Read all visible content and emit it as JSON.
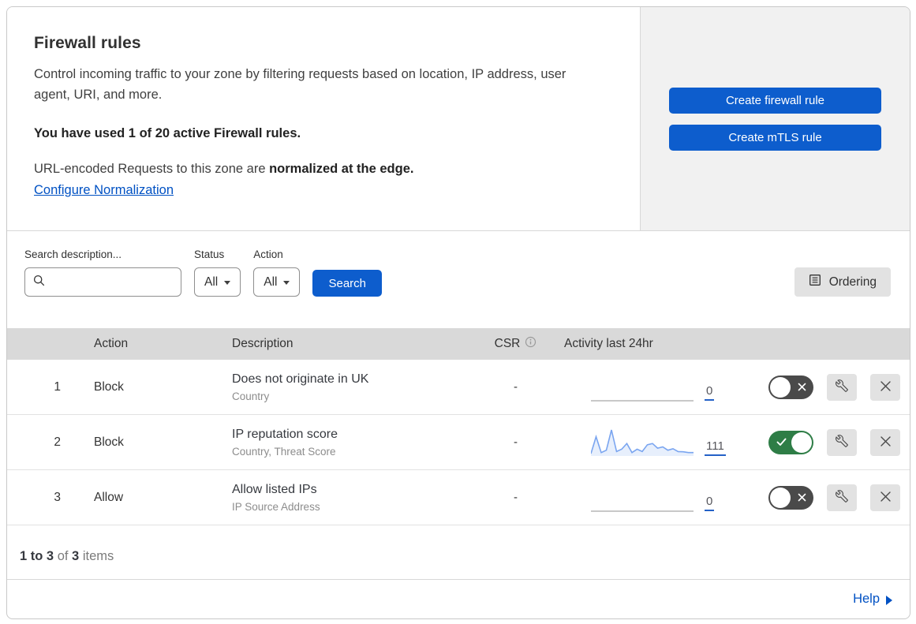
{
  "header": {
    "title": "Firewall rules",
    "description": "Control incoming traffic to your zone by filtering requests based on location, IP address, user agent, URI, and more.",
    "usage_line": "You have used 1 of 20 active Firewall rules.",
    "normalization_prefix": "URL-encoded Requests to this zone are ",
    "normalization_bold": "normalized at the edge.",
    "normalization_link": "Configure Normalization",
    "buttons": [
      {
        "label": "Create firewall rule"
      },
      {
        "label": "Create mTLS rule"
      }
    ]
  },
  "filters": {
    "search_label": "Search description...",
    "search_value": "",
    "status_label": "Status",
    "status_value": "All",
    "action_label": "Action",
    "action_value": "All",
    "search_button": "Search",
    "ordering_button": "Ordering"
  },
  "table": {
    "columns": {
      "action": "Action",
      "description": "Description",
      "csr": "CSR",
      "activity": "Activity last 24hr"
    },
    "rows": [
      {
        "priority": "1",
        "action": "Block",
        "description": "Does not originate in UK",
        "criteria": "Country",
        "csr": "-",
        "activity_count": "0",
        "enabled": false,
        "sparkline": [
          0,
          0,
          0,
          0,
          0,
          0,
          0,
          0,
          0,
          0,
          0,
          0,
          0,
          0,
          0,
          0,
          0,
          0,
          0,
          0,
          0
        ]
      },
      {
        "priority": "2",
        "action": "Block",
        "description": "IP reputation score",
        "criteria": "Country, Threat Score",
        "csr": "-",
        "activity_count": "111",
        "enabled": true,
        "sparkline": [
          9,
          74,
          13,
          22,
          100,
          17,
          26,
          48,
          13,
          26,
          17,
          43,
          48,
          30,
          35,
          22,
          28,
          17,
          16,
          13,
          13
        ]
      },
      {
        "priority": "3",
        "action": "Allow",
        "description": "Allow listed IPs",
        "criteria": "IP Source Address",
        "csr": "-",
        "activity_count": "0",
        "enabled": false,
        "sparkline": [
          0,
          0,
          0,
          0,
          0,
          0,
          0,
          0,
          0,
          0,
          0,
          0,
          0,
          0,
          0,
          0,
          0,
          0,
          0,
          0,
          0
        ]
      }
    ]
  },
  "footer": {
    "range_bold": "1 to 3",
    "of_text": " of ",
    "total_bold": "3",
    "items_text": " items",
    "help_link": "Help"
  },
  "colors": {
    "accent_blue": "#0d5dcd",
    "link_blue": "#0051c3",
    "toggle_on_green": "#2e7d46",
    "toggle_off_gray": "#4a4a4a",
    "sparkline_blue": "#7aa5f0",
    "sparkline_fill": "rgba(122,165,240,0.18)",
    "sparkline_zero_gray": "#b5b5b5",
    "table_header_gray": "#d9d9d9",
    "panel_gray": "#f1f1f1"
  }
}
